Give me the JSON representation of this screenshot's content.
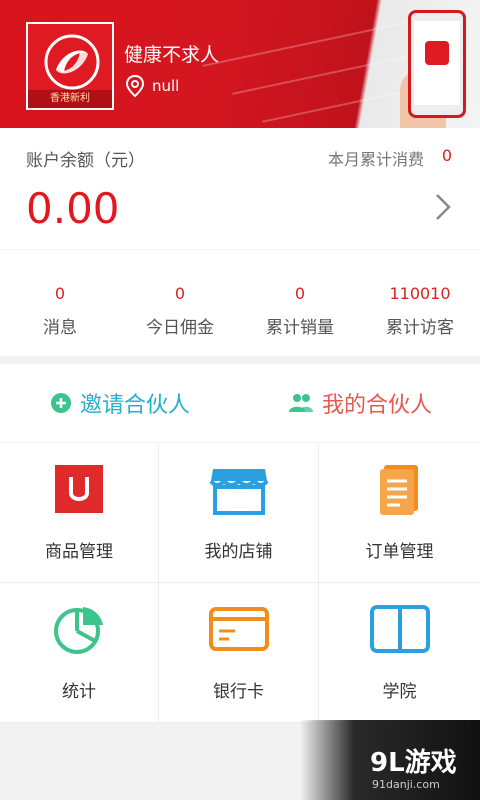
{
  "header": {
    "shop_name": "健康不求人",
    "location": "null",
    "logo_caption": "香港新利"
  },
  "balance": {
    "label": "账户余额（元）",
    "value": "0.00",
    "month_label": "本月累计消费",
    "month_value": "0"
  },
  "stats": [
    {
      "value": "0",
      "label": "消息"
    },
    {
      "value": "0",
      "label": "今日佣金"
    },
    {
      "value": "0",
      "label": "累计销量"
    },
    {
      "value": "110010",
      "label": "累计访客"
    }
  ],
  "partner": {
    "invite_label": "邀请合伙人",
    "mine_label": "我的合伙人"
  },
  "grid": [
    {
      "label": "商品管理",
      "icon": "product-icon",
      "color": "#e02a2a"
    },
    {
      "label": "我的店铺",
      "icon": "store-icon",
      "color": "#2aa0e0"
    },
    {
      "label": "订单管理",
      "icon": "order-icon",
      "color": "#f28c1e"
    },
    {
      "label": "统计",
      "icon": "chart-icon",
      "color": "#3cc48c"
    },
    {
      "label": "银行卡",
      "icon": "bank-card-icon",
      "color": "#f28c1e"
    },
    {
      "label": "学院",
      "icon": "book-icon",
      "color": "#2aa0e0"
    }
  ],
  "watermark": {
    "text": "9L游戏",
    "url": "91danji.com"
  },
  "colors": {
    "brand_red": "#d9141e",
    "accent_cyan": "#25b0cc",
    "accent_coral": "#e8584f"
  }
}
